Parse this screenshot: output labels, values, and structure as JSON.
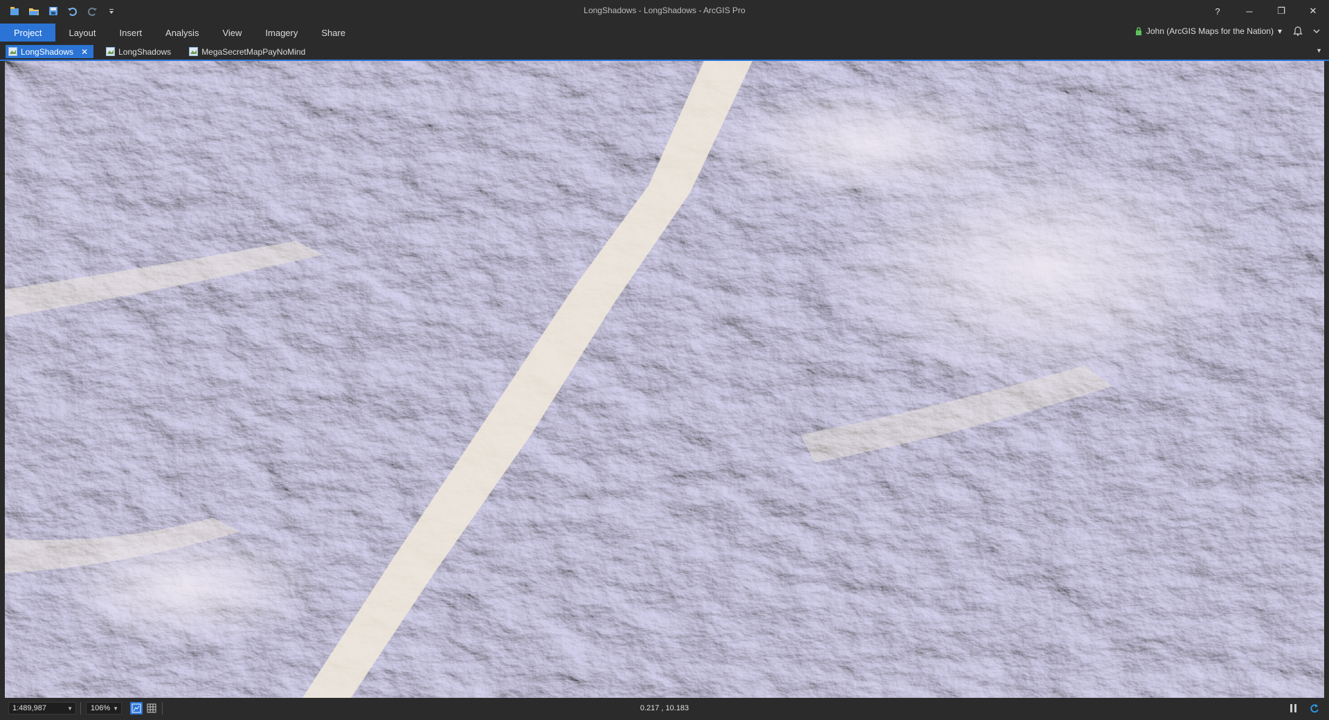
{
  "window": {
    "title": "LongShadows - LongShadows - ArcGIS Pro",
    "help_label": "?",
    "minimize_label": "─",
    "restore_label": "❐",
    "close_label": "✕"
  },
  "quick_access": {
    "icons": [
      "new-project-icon",
      "open-project-icon",
      "save-project-icon",
      "undo-icon",
      "redo-icon",
      "customize-qat-icon"
    ]
  },
  "ribbon": {
    "tabs": [
      {
        "label": "Project",
        "active": true
      },
      {
        "label": "Layout"
      },
      {
        "label": "Insert"
      },
      {
        "label": "Analysis"
      },
      {
        "label": "View"
      },
      {
        "label": "Imagery"
      },
      {
        "label": "Share"
      }
    ],
    "user": "John (ArcGIS Maps for the Nation)",
    "user_caret": "▾"
  },
  "document_tabs": [
    {
      "label": "LongShadows",
      "active": true,
      "close": "✕"
    },
    {
      "label": "LongShadows"
    },
    {
      "label": "MegaSecretMapPayNoMind"
    }
  ],
  "doc_dropdown": "▼",
  "status": {
    "scale": "1:489,987",
    "zoom": "106%",
    "coordinates": "0.217 , 10.183"
  },
  "colors": {
    "accent": "#2b74d6",
    "chrome": "#2b2b2b",
    "map_base": "#e8e3f2",
    "map_shadow": "#8b86d6",
    "map_valley": "#ece4d8"
  }
}
